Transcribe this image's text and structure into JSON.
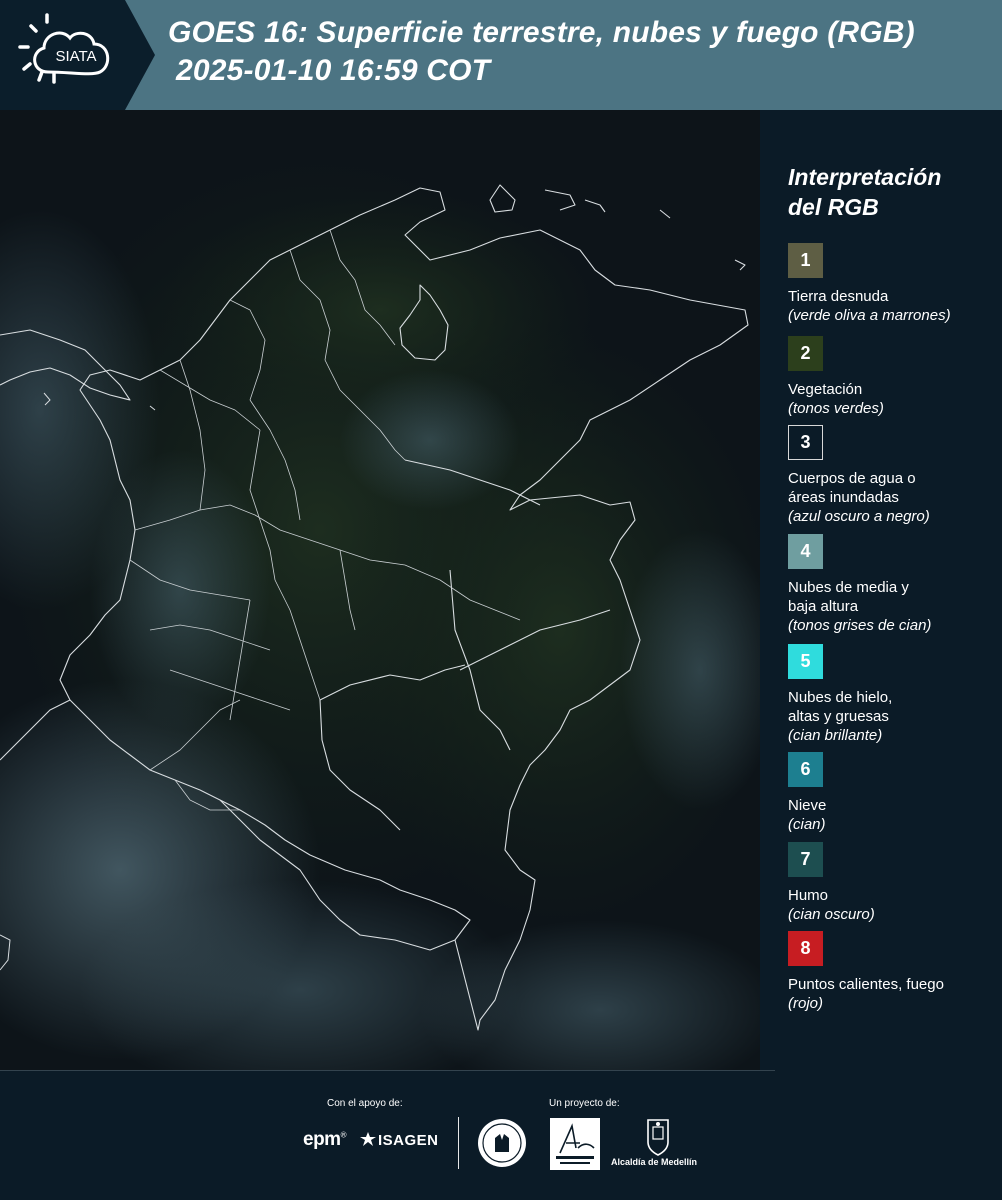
{
  "header": {
    "logo_text": "SIATA",
    "title_line1": "GOES 16: Superficie terrestre, nubes y fuego (RGB)",
    "title_line2": "2025-01-10 16:59 COT",
    "bar_color": "#4c7483",
    "logo_bg": "#0b1e2b"
  },
  "legend": {
    "title": "Interpretación\ndel RGB",
    "items": [
      {
        "num": "1",
        "color": "#5e5e44",
        "label": "Tierra desnuda",
        "sub": "(verde oliva a marrones)"
      },
      {
        "num": "2",
        "color": "#2c3f1c",
        "label": "Vegetación",
        "sub": "(tonos verdes)"
      },
      {
        "num": "3",
        "color": "#0b1b27",
        "label": "Cuerpos de agua o\náreas inundadas",
        "sub": "(azul oscuro a negro)"
      },
      {
        "num": "4",
        "color": "#6f9ea0",
        "label": "Nubes de media y\nbaja altura",
        "sub": "(tonos grises de cian)"
      },
      {
        "num": "5",
        "color": "#2fdcdd",
        "label": "Nubes de hielo,\naltas y gruesas",
        "sub": "(cian brillante)"
      },
      {
        "num": "6",
        "color": "#1d7f90",
        "label": "Nieve",
        "sub": "(cian)"
      },
      {
        "num": "7",
        "color": "#1d4e50",
        "label": "Humo",
        "sub": "(cian oscuro)"
      },
      {
        "num": "8",
        "color": "#c71d22",
        "label": "Puntos calientes, fuego",
        "sub": "(rojo)"
      }
    ]
  },
  "footer": {
    "support_label": "Con el apoyo de:",
    "project_label": "Un proyecto de:",
    "epm": "epm",
    "epm_mark": "®",
    "isagen": "ISAGEN",
    "alcaldia": "Alcaldía de Medellín"
  }
}
